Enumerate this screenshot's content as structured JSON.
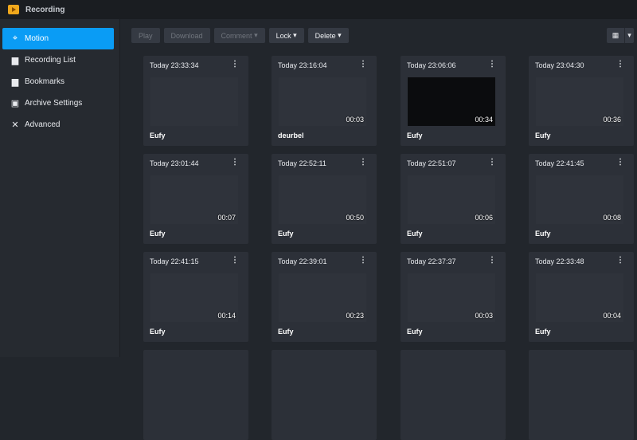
{
  "app": {
    "title": "Recording"
  },
  "sidebar": {
    "items": [
      {
        "label": "Motion",
        "icon": "crosshair-icon",
        "active": true
      },
      {
        "label": "Recording List",
        "icon": "folder-video-icon"
      },
      {
        "label": "Bookmarks",
        "icon": "folder-bookmark-icon"
      },
      {
        "label": "Archive Settings",
        "icon": "archive-icon"
      },
      {
        "label": "Advanced",
        "icon": "tools-icon"
      }
    ]
  },
  "toolbar": {
    "play": "Play",
    "download": "Download",
    "comment": "Comment",
    "lock": "Lock",
    "delete": "Delete"
  },
  "recordings": [
    {
      "time": "Today 23:33:34",
      "duration": "",
      "camera": "Eufy"
    },
    {
      "time": "Today 23:16:04",
      "duration": "00:03",
      "camera": "deurbel"
    },
    {
      "time": "Today 23:06:06",
      "duration": "00:34",
      "camera": "Eufy"
    },
    {
      "time": "Today 23:04:30",
      "duration": "00:36",
      "camera": "Eufy"
    },
    {
      "time": "Today 23:01:44",
      "duration": "00:07",
      "camera": "Eufy"
    },
    {
      "time": "Today 22:52:11",
      "duration": "00:50",
      "camera": "Eufy"
    },
    {
      "time": "Today 22:51:07",
      "duration": "00:06",
      "camera": "Eufy"
    },
    {
      "time": "Today 22:41:45",
      "duration": "00:08",
      "camera": "Eufy"
    },
    {
      "time": "Today 22:41:15",
      "duration": "00:14",
      "camera": "Eufy"
    },
    {
      "time": "Today 22:39:01",
      "duration": "00:23",
      "camera": "Eufy"
    },
    {
      "time": "Today 22:37:37",
      "duration": "00:03",
      "camera": "Eufy"
    },
    {
      "time": "Today 22:33:48",
      "duration": "00:04",
      "camera": "Eufy"
    }
  ]
}
